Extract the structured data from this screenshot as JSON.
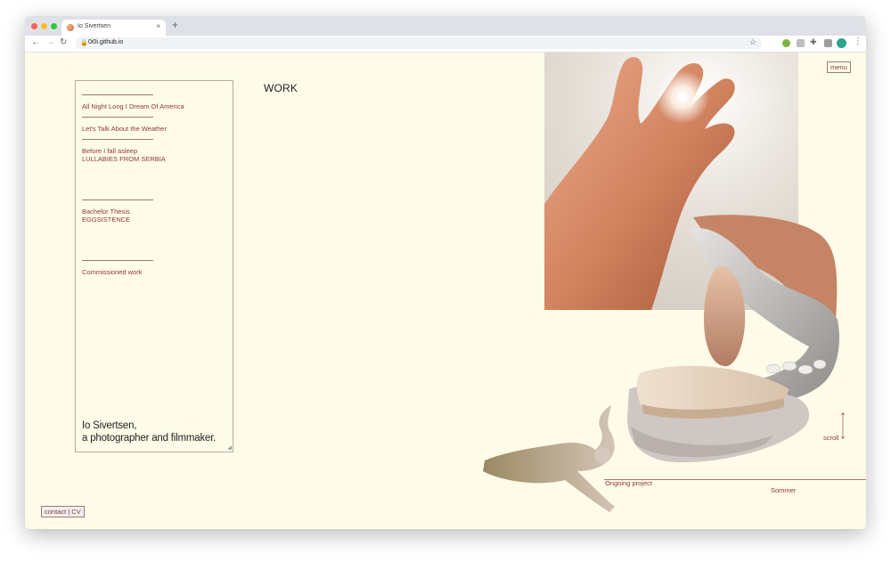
{
  "browser": {
    "tab_title": "Io Sivertsen",
    "tab_close": "×",
    "new_tab": "+",
    "url": "0i0i.github.io",
    "back": "←",
    "forward": "→",
    "reload": "↻",
    "lock": "🔒",
    "star": "☆",
    "puzzle": "✚",
    "kebab": "⋮"
  },
  "page": {
    "heading": "WORK",
    "menu_label": "menu",
    "contact_label": "contact | CV",
    "scroll_label": "scroll",
    "about_line1": "Io Sivertsen,",
    "about_line2": "a photographer and filmmaker."
  },
  "sidebar": {
    "items": [
      {
        "line1": "All Night Long I Dream Of America",
        "line2": ""
      },
      {
        "line1": "Let's Talk About the Weather",
        "line2": ""
      },
      {
        "line1": "Before I fall asleep",
        "line2": "LULLABIES FROM SERBIA"
      },
      {
        "line1": "Bachelor Thesis",
        "line2": "EGGSISTENCE"
      },
      {
        "line1": "Commissioned work",
        "line2": ""
      }
    ]
  },
  "projects": {
    "left": "Ongoing project",
    "right": "Sommer"
  },
  "colors": {
    "background": "#fffbe9",
    "link": "#8b3a3a",
    "border": "#b7ad9a"
  }
}
